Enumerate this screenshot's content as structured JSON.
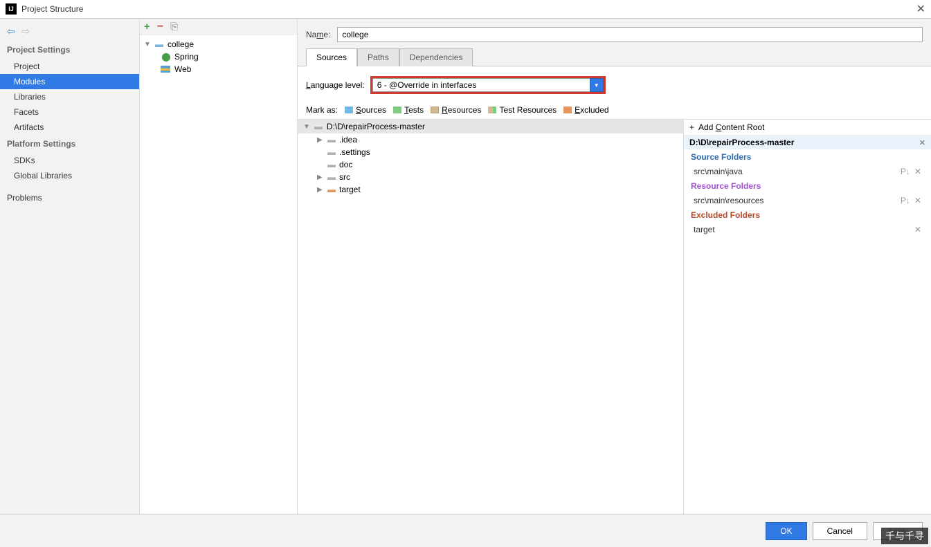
{
  "window": {
    "title": "Project Structure"
  },
  "nav": {
    "section1": "Project Settings",
    "items1": [
      "Project",
      "Modules",
      "Libraries",
      "Facets",
      "Artifacts"
    ],
    "section2": "Platform Settings",
    "items2": [
      "SDKs",
      "Global Libraries"
    ],
    "problems": "Problems"
  },
  "tree": {
    "root": "college",
    "children": [
      "Spring",
      "Web"
    ]
  },
  "form": {
    "name_label": "Name:",
    "name_value": "college"
  },
  "tabs": [
    "Sources",
    "Paths",
    "Dependencies"
  ],
  "language": {
    "label": "Language level:",
    "value": "6 - @Override in interfaces"
  },
  "markas": {
    "label": "Mark as:",
    "sources": "Sources",
    "tests": "Tests",
    "resources": "Resources",
    "test_resources": "Test Resources",
    "excluded": "Excluded"
  },
  "files": {
    "root": "D:\\D\\repairProcess-master",
    "items": [
      {
        "name": ".idea",
        "expandable": true,
        "color": "gray"
      },
      {
        "name": ".settings",
        "expandable": false,
        "color": "gray"
      },
      {
        "name": "doc",
        "expandable": false,
        "color": "gray"
      },
      {
        "name": "src",
        "expandable": true,
        "color": "gray"
      },
      {
        "name": "target",
        "expandable": true,
        "color": "orange"
      }
    ]
  },
  "right": {
    "add_root": "Add Content Root",
    "root_path": "D:\\D\\repairProcess-master",
    "source_title": "Source Folders",
    "source_items": [
      "src\\main\\java"
    ],
    "resource_title": "Resource Folders",
    "resource_items": [
      "src\\main\\resources"
    ],
    "excluded_title": "Excluded Folders",
    "excluded_items": [
      "target"
    ]
  },
  "footer": {
    "ok": "OK",
    "cancel": "Cancel",
    "apply": "Apply"
  },
  "watermark": "千与千寻"
}
